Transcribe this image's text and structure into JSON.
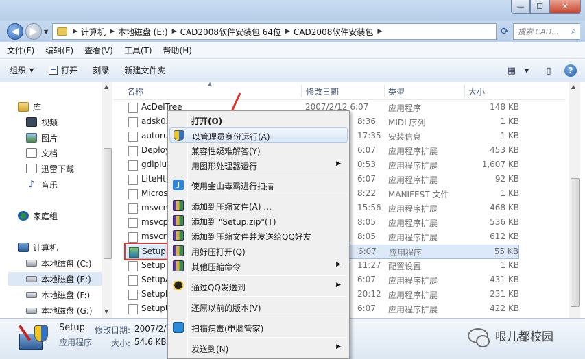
{
  "window": {
    "min_label": "—",
    "max_label": "☐",
    "close_label": "✕"
  },
  "address": {
    "crumbs": [
      "计算机",
      "本地磁盘 (E:)",
      "CAD2008软件安装包 64位",
      "CAD2008软件安装包"
    ],
    "search_placeholder": "搜索 CAD..."
  },
  "menu": [
    "文件(F)",
    "编辑(E)",
    "查看(V)",
    "工具(T)",
    "帮助(H)"
  ],
  "toolbar": {
    "organize": "组织",
    "open": "打开",
    "burn": "刻录",
    "new_folder": "新建文件夹"
  },
  "nav": {
    "library": "库",
    "videos": "视频",
    "pictures": "图片",
    "documents": "文档",
    "xunlei": "迅雷下载",
    "music": "音乐",
    "homegroup": "家庭组",
    "computer": "计算机",
    "drive_c": "本地磁盘 (C:)",
    "drive_e": "本地磁盘 (E:)",
    "drive_f": "本地磁盘 (F:)",
    "drive_g": "本地磁盘 (G:)"
  },
  "columns": {
    "name": "名称",
    "date": "修改日期",
    "type": "类型",
    "size": "大小"
  },
  "files": [
    {
      "name": "AcDelTree",
      "date": "2007/2/12 6:07",
      "type": "应用程序",
      "size": "148 KB"
    },
    {
      "name": "adsk02",
      "date": "8:36",
      "type": "MIDI 序列",
      "size": "1 KB"
    },
    {
      "name": "autorun",
      "date": "17:35",
      "type": "安装信息",
      "size": "1 KB"
    },
    {
      "name": "Deploy",
      "date": "6:07",
      "type": "应用程序扩展",
      "size": "453 KB"
    },
    {
      "name": "gdiplus",
      "date": "0:53",
      "type": "应用程序扩展",
      "size": "1,607 KB"
    },
    {
      "name": "LiteHtml",
      "date": "6:07",
      "type": "应用程序扩展",
      "size": "92 KB"
    },
    {
      "name": "Microsoft",
      "date": "8:22",
      "type": "MANIFEST 文件",
      "size": "1 KB"
    },
    {
      "name": "msvcm",
      "date": "15:56",
      "type": "应用程序扩展",
      "size": "468 KB"
    },
    {
      "name": "msvcp",
      "date": "8:05",
      "type": "应用程序扩展",
      "size": "536 KB"
    },
    {
      "name": "msvcr8",
      "date": "8:05",
      "type": "应用程序扩展",
      "size": "612 KB"
    },
    {
      "name": "Setup",
      "date": "6:07",
      "type": "应用程序",
      "size": "55 KB"
    },
    {
      "name": "Setup",
      "date": "11:27",
      "type": "配置设置",
      "size": "1 KB"
    },
    {
      "name": "SetupA",
      "date": "6:07",
      "type": "应用程序扩展",
      "size": "431 KB"
    },
    {
      "name": "SetupR",
      "date": "20:12",
      "type": "应用程序扩展",
      "size": "231 KB"
    },
    {
      "name": "SetupU",
      "date": "6:07",
      "type": "应用程序扩展",
      "size": "422 KB"
    }
  ],
  "context_menu": {
    "open": "打开(O)",
    "run_as_admin": "以管理员身份运行(A)",
    "compat": "兼容性疑难解答(Y)",
    "open_with_graphics": "用图形处理器运行",
    "kingsoft_scan": "使用金山毒霸进行扫描",
    "add_archive": "添加到压缩文件(A) ...",
    "add_setup_zip": "添加到 \"Setup.zip\"(T)",
    "add_send_qq": "添加到压缩文件并发送给QQ好友",
    "haozip_open": "用好压打开(Q)",
    "other_zip": "其他压缩命令",
    "send_qq": "通过QQ发送到",
    "restore": "还原以前的版本(V)",
    "scan_virus": "扫描病毒(电脑管家)",
    "send_to": "发送到(N)"
  },
  "details": {
    "name": "Setup",
    "type": "应用程序",
    "modified_key": "修改日期:",
    "modified_val": "2007/2/1",
    "size_key": "大小:",
    "size_val": "54.6 KB"
  },
  "watermark": "哏儿都校园"
}
